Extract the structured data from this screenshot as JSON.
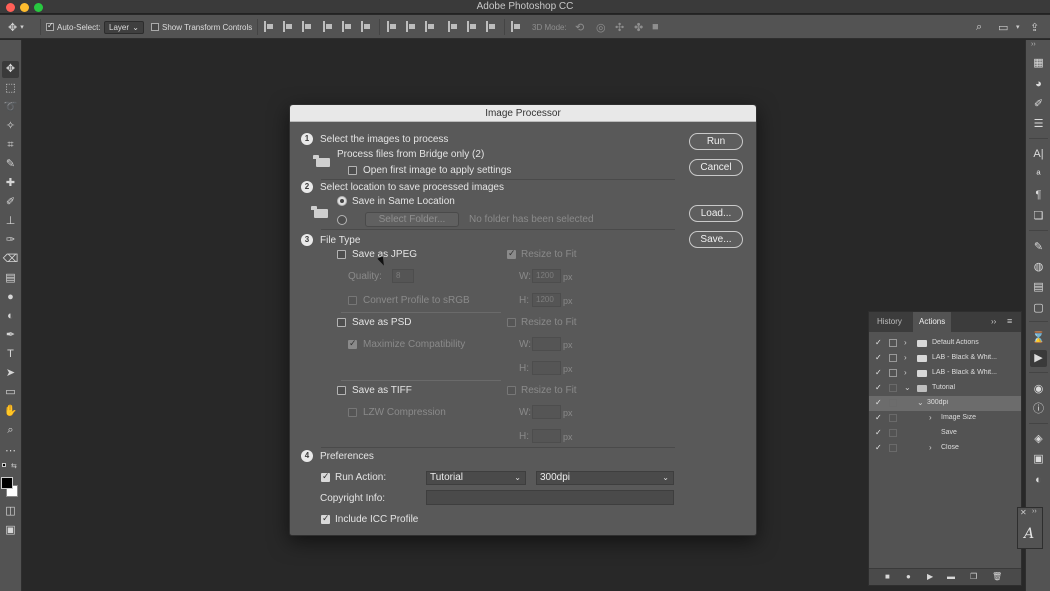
{
  "window": {
    "title": "Adobe Photoshop CC"
  },
  "options_bar": {
    "auto_select_label": "Auto-Select:",
    "auto_select_value": "Layer",
    "show_transform_label": "Show Transform Controls",
    "mode_3d_label": "3D Mode:"
  },
  "dialog": {
    "title": "Image Processor",
    "section1": {
      "number": "1",
      "heading": "Select the images to process",
      "source_text": "Process files from Bridge only (2)",
      "open_first_label": "Open first image to apply settings"
    },
    "section2": {
      "number": "2",
      "heading": "Select location to save processed images",
      "same_location_label": "Save in Same Location",
      "select_folder_label": "Select Folder...",
      "no_folder_text": "No folder has been selected"
    },
    "section3": {
      "number": "3",
      "heading": "File Type",
      "jpeg": {
        "label": "Save as JPEG",
        "resize_label": "Resize to Fit",
        "quality_label": "Quality:",
        "quality_value": "8",
        "convert_label": "Convert Profile to sRGB",
        "w_label": "W:",
        "w_value": "1200",
        "h_label": "H:",
        "h_value": "1200",
        "unit": "px"
      },
      "psd": {
        "label": "Save as PSD",
        "resize_label": "Resize to Fit",
        "maximize_label": "Maximize Compatibility",
        "w_label": "W:",
        "h_label": "H:",
        "unit": "px"
      },
      "tiff": {
        "label": "Save as TIFF",
        "resize_label": "Resize to Fit",
        "lzw_label": "LZW Compression",
        "w_label": "W:",
        "h_label": "H:",
        "unit": "px"
      }
    },
    "section4": {
      "number": "4",
      "heading": "Preferences",
      "run_action_label": "Run Action:",
      "action_set_value": "Tutorial",
      "action_value": "300dpi",
      "copyright_label": "Copyright Info:",
      "copyright_value": "",
      "icc_label": "Include ICC Profile"
    },
    "buttons": {
      "run": "Run",
      "cancel": "Cancel",
      "load": "Load...",
      "save": "Save..."
    }
  },
  "actions_panel": {
    "tabs": [
      "History",
      "Actions"
    ],
    "items": [
      {
        "label": "Default Actions"
      },
      {
        "label": "LAB - Black & Whit..."
      },
      {
        "label": "LAB - Black & Whit..."
      },
      {
        "label": "Tutorial"
      },
      {
        "label": "300dpi"
      },
      {
        "label": "Image Size"
      },
      {
        "label": "Save"
      },
      {
        "label": "Close"
      }
    ]
  }
}
